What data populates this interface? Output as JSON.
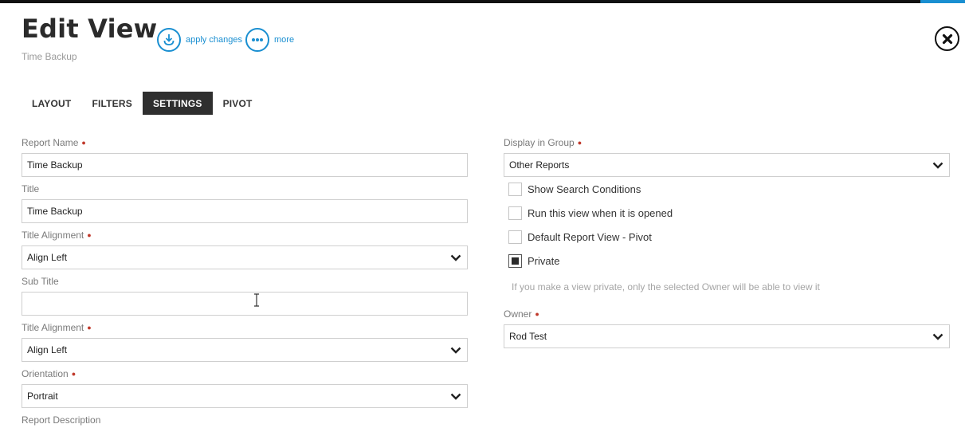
{
  "header": {
    "title": "Edit View",
    "subtitle": "Time Backup",
    "actions": {
      "apply": {
        "label": "apply changes",
        "icon": "download-icon"
      },
      "more": {
        "label": "more",
        "icon": "ellipsis-icon"
      }
    },
    "close_icon": "close-icon"
  },
  "tabs": [
    {
      "label": "LAYOUT",
      "active": false
    },
    {
      "label": "FILTERS",
      "active": false
    },
    {
      "label": "SETTINGS",
      "active": true
    },
    {
      "label": "PIVOT",
      "active": false
    }
  ],
  "left_form": {
    "report_name": {
      "label": "Report Name",
      "value": "Time Backup"
    },
    "title": {
      "label": "Title",
      "value": "Time Backup"
    },
    "title_alignment": {
      "label": "Title Alignment",
      "value": "Align Left"
    },
    "sub_title": {
      "label": "Sub Title",
      "value": ""
    },
    "sub_title_alignment": {
      "label": "Title Alignment",
      "value": "Align Left"
    },
    "orientation": {
      "label": "Orientation",
      "value": "Portrait"
    },
    "report_description": {
      "label": "Report Description"
    }
  },
  "right_form": {
    "display_in_group": {
      "label": "Display in Group",
      "value": "Other Reports"
    },
    "checkboxes": [
      {
        "label": "Show Search Conditions",
        "checked": false
      },
      {
        "label": "Run this view when it is opened",
        "checked": false
      },
      {
        "label": "Default Report View - Pivot",
        "checked": false
      },
      {
        "label": "Private",
        "checked": true
      }
    ],
    "private_hint": "If you make a view private, only the selected Owner will be able to view it",
    "owner": {
      "label": "Owner",
      "value": "Rod Test"
    }
  },
  "colors": {
    "accent": "#1a8fd1",
    "active_tab": "#2f2f2f",
    "required": "#c0392b"
  }
}
